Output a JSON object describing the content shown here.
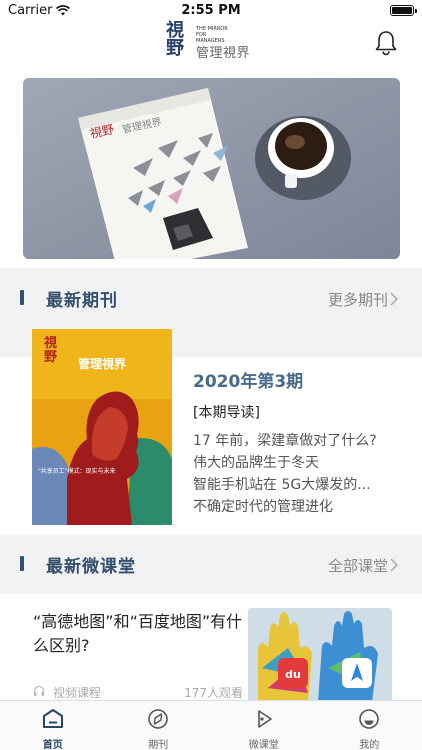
{
  "status_bar": {
    "carrier": "Carrier",
    "time": "2:55 PM"
  },
  "header": {
    "logo": {
      "big": "視野",
      "small": "THE MIRROR FOR MANAGERS",
      "cn": "管理視界"
    },
    "bell_icon": "bell-icon"
  },
  "sections": {
    "latest_issue": {
      "title": "最新期刊",
      "more": "更多期刊"
    },
    "latest_class": {
      "title": "最新微课堂",
      "more": "全部课堂"
    }
  },
  "issue": {
    "year": "2020年第3期",
    "guide": "[本期导读]",
    "lines": [
      "17 年前，梁建章做对了什么?",
      "伟大的品牌生于冬天",
      "智能手机站在 5G大爆发的...",
      "不确定时代的管理进化"
    ],
    "cover": {
      "big": "視野",
      "cn": "管理視界",
      "tagline": "\"共享员工\"模式：现实与未来"
    }
  },
  "micro_class": {
    "question": "“高德地图”和“百度地图”有什么区别?",
    "type": "视频课程",
    "views": "177人观看"
  },
  "tabs": [
    {
      "label": "首页",
      "icon": "home-icon",
      "active": true
    },
    {
      "label": "期刊",
      "icon": "journal-icon",
      "active": false
    },
    {
      "label": "微课堂",
      "icon": "play-icon",
      "active": false
    },
    {
      "label": "我的",
      "icon": "profile-icon",
      "active": false
    }
  ],
  "colors": {
    "accent": "#35506e",
    "issue_year": "#4a6b88",
    "cover_bg": "#f0b51a"
  }
}
